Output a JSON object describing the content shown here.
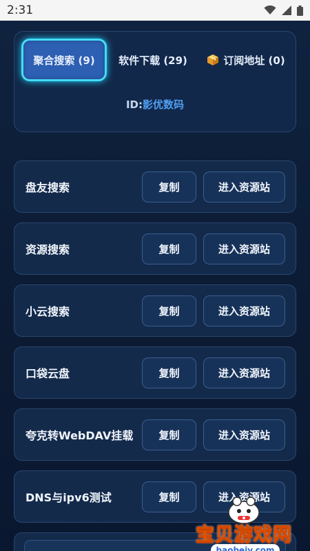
{
  "status_bar": {
    "time": "2:31",
    "icons": [
      "wifi-icon",
      "signal-icon",
      "battery-icon"
    ]
  },
  "tabs": [
    {
      "label": "聚合搜索 (9)",
      "active": true
    },
    {
      "label": "软件下载 (29)",
      "active": false
    },
    {
      "label": "订阅地址 (0)",
      "active": false,
      "icon": "box-icon"
    }
  ],
  "id_line": {
    "prefix": "ID:",
    "value": "影优数码"
  },
  "resources": [
    {
      "name": "盘友搜索",
      "copy_label": "复制",
      "enter_label": "进入资源站"
    },
    {
      "name": "资源搜索",
      "copy_label": "复制",
      "enter_label": "进入资源站"
    },
    {
      "name": "小云搜索",
      "copy_label": "复制",
      "enter_label": "进入资源站"
    },
    {
      "name": "口袋云盘",
      "copy_label": "复制",
      "enter_label": "进入资源站"
    },
    {
      "name": "夸克转WebDAV挂载",
      "copy_label": "复制",
      "enter_label": "进入资源站"
    },
    {
      "name": "DNS与ipv6测试",
      "copy_label": "复制",
      "enter_label": "进入资源站"
    }
  ],
  "watermark": {
    "title": "宝贝游戏网",
    "url": "baobeiy.com"
  },
  "colors": {
    "background": "#0c1a33",
    "card": "#132a4b",
    "active_tab": "#2d5fb2",
    "active_glow": "#43dcf6",
    "id_value": "#4f9ef2"
  }
}
